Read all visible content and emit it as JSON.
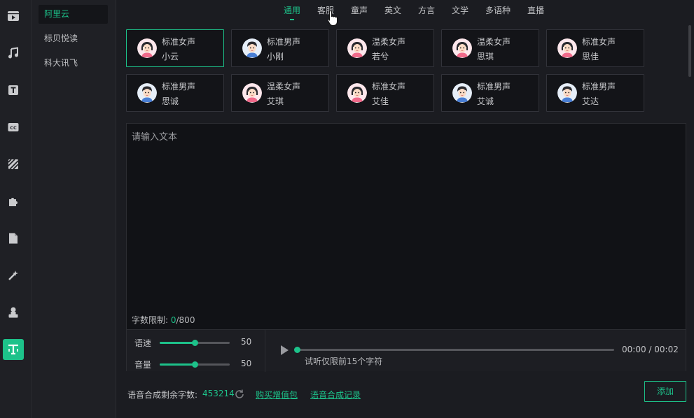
{
  "sidebar": {
    "icons": [
      "video-icon",
      "music-icon",
      "text-icon",
      "subtitle-cc-icon",
      "filter-icon",
      "plugin-icon",
      "file-icon",
      "magic-wand-icon",
      "user-stamp-icon",
      "text-to-speech-icon"
    ],
    "active_index": 9
  },
  "providers": {
    "items": [
      "阿里云",
      "标贝悦读",
      "科大讯飞"
    ],
    "active_index": 0
  },
  "tabs": {
    "items": [
      "通用",
      "客服",
      "童声",
      "英文",
      "方言",
      "文学",
      "多语种",
      "直播"
    ],
    "active_index": 0
  },
  "voices": [
    {
      "type": "标准女声",
      "name": "小云",
      "gender": "female",
      "active": true
    },
    {
      "type": "标准男声",
      "name": "小刚",
      "gender": "male"
    },
    {
      "type": "温柔女声",
      "name": "若兮",
      "gender": "female"
    },
    {
      "type": "温柔女声",
      "name": "思琪",
      "gender": "female"
    },
    {
      "type": "标准女声",
      "name": "思佳",
      "gender": "female"
    },
    {
      "type": "标准男声",
      "name": "思诚",
      "gender": "male"
    },
    {
      "type": "温柔女声",
      "name": "艾琪",
      "gender": "female"
    },
    {
      "type": "标准女声",
      "name": "艾佳",
      "gender": "female"
    },
    {
      "type": "标准男声",
      "name": "艾诚",
      "gender": "male"
    },
    {
      "type": "标准男声",
      "name": "艾达",
      "gender": "male"
    }
  ],
  "editor": {
    "placeholder": "请输入文本",
    "limit_label": "字数限制: ",
    "limit_count": "0",
    "limit_max": "/800"
  },
  "controls": {
    "speed_label": "语速",
    "speed_value": "50",
    "speed_fraction": 0.5,
    "volume_label": "音量",
    "volume_value": "50",
    "volume_fraction": 0.5,
    "time": "00:00 / 00:02",
    "preview_note": "试听仅限前15个字符"
  },
  "footer": {
    "remain_label": "语音合成剩余字数:",
    "remain_value": "453214",
    "buy_link": "购买增值包",
    "history_link": "语音合成记录",
    "add_button": "添加"
  },
  "colors": {
    "accent": "#1dc28a",
    "background": "#1b1c21"
  }
}
